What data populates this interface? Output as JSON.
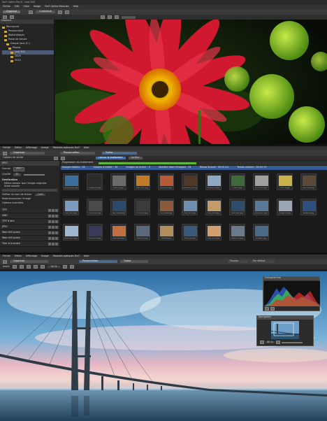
{
  "panel1": {
    "title": "DxO Optics Pro 6 - Last 300",
    "menu": [
      "Fichier",
      "Edit",
      "View",
      "Image",
      "DxO Optics Modules",
      "Help"
    ],
    "tabs": [
      "Organize",
      "Customize"
    ],
    "tree": [
      "Raccourcis",
      "Personnalisé",
      "Bibliothèques",
      "Poste de travail",
      "Disque local (C:)",
      "Photos",
      "Last 300",
      "2009",
      "2010"
    ],
    "sidebar_header": "Dossiers"
  },
  "panel2": {
    "menu": [
      "Fichier",
      "Editer",
      "Affichage",
      "Image",
      "Modules optiques DxO",
      "Aide"
    ],
    "tabs": [
      "Organiser",
      "Personnaliser",
      "Traiter"
    ],
    "progress_label": "Progression du traitement",
    "stats": [
      "Images totales : 34",
      "Images à traiter : 34",
      "Images en erreur : 0",
      "Nombre total d'images : 34",
      "Temps écoulé : 00:00:24",
      "Temps restant : 00:01:19"
    ],
    "launch_button": "Lancer le traitement",
    "stop_button": "Arrêter",
    "options_title": "Options de sortie",
    "format_label": "Format",
    "format_value": "JPEG",
    "quality_label": "Qualité",
    "quality_value": "95",
    "dest_label": "Destination",
    "dest_options": [
      "Même dossier que l'image originale",
      "Autre dossier"
    ],
    "suffix_label": "Suffixe du nom de fichier",
    "suffix_value": "_DxO",
    "redim_label": "Redimensionner l'image",
    "advanced_label": "Options avancées",
    "rows": [
      "TIFF",
      "DNG",
      "TIFF 8 bits",
      "JPEG",
      "Web 800 pixels",
      "Web 400 pixels",
      "Tirer à la photo"
    ],
    "captions": [
      "Vilnius_0880.jpg",
      "flowers_01.jpg",
      "boat_13.jpg",
      "DSC_2547.jpg",
      "IMG_0401.jpg",
      "DSC0088_0015.jpg",
      "Lindau_01.jpg",
      "STREET.jpg",
      "ETHI_MEC.jpg",
      "2793 B.jpg",
      "IMG 3042.jpg",
      "IMG_3033.jpg",
      "Chin_0005.jpg",
      "DSC_Ballet.jpg",
      "Fort_2014.jpg",
      "Tort_purse.jpg",
      "DSC_0221.jpg",
      "IMG_0046.jpg",
      "IMG_0021.jpg",
      "MUSI_0017.jpg",
      "Bridge_01.jpg",
      "Balwings.jpg",
      "Blowing_01.jpg",
      "DSC_0078.jpg",
      "IMG_0402.jpg",
      "Stairs_01.jpg",
      "Venezia.jpg",
      "blinds_01.jpg",
      "DSC_0305.jpg",
      "dubai_TAH.jpg",
      "bridge_7.jpg"
    ]
  },
  "panel3": {
    "menu": [
      "Fichier",
      "Editer",
      "Affichage",
      "Image",
      "Modules optiques DxO",
      "Aide"
    ],
    "tabs": [
      "Organiser",
      "Personnaliser",
      "Traiter"
    ],
    "zoom": "50 %",
    "dropdown_right": [
      "Favoris",
      "Par défaut"
    ],
    "histogram_title": "Histogramme",
    "nav_title": "Navigateur",
    "nav_zoom": "50 %",
    "toolbar_left": "Avant"
  }
}
